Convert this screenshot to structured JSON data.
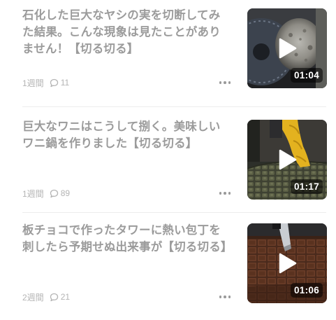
{
  "feed": {
    "items": [
      {
        "title": "石化した巨大なヤシの実を切断してみた結果。こんな現象は見たことがありません！【切る切る】",
        "age": "1週間",
        "comments": "11",
        "duration": "01:04",
        "thumbnail": "petrified-coconut-cut-scene"
      },
      {
        "title": "巨大なワニはこうして捌く。美味しいワニ鍋を作りました【切る切る】",
        "age": "1週間",
        "comments": "89",
        "duration": "01:17",
        "thumbnail": "crocodile-butchering-scene"
      },
      {
        "title": "板チョコで作ったタワーに熱い包丁を刺したら予期せぬ出来事が【切る切る】",
        "age": "2週間",
        "comments": "21",
        "duration": "01:06",
        "thumbnail": "chocolate-tower-knife-scene"
      }
    ],
    "icons": {
      "comment": "speech-bubble-icon",
      "more": "more-dots-icon",
      "play": "play-icon"
    },
    "colors": {
      "title_text": "#9b9b9b",
      "meta_text": "#b4b4b4",
      "badge_bg": "rgba(0,0,0,0.55)",
      "divider": "#ededed"
    }
  }
}
